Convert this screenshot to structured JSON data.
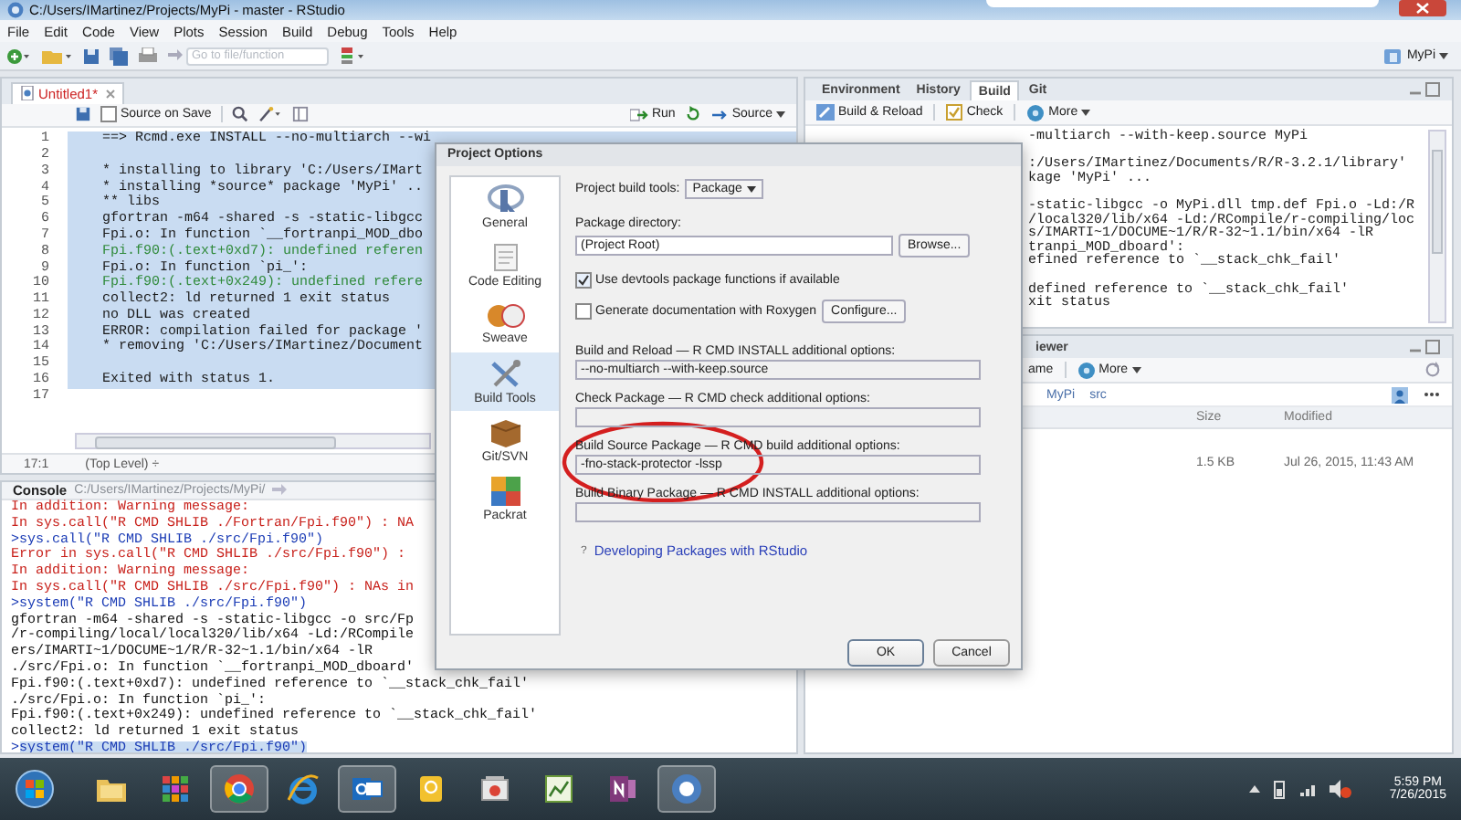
{
  "window": {
    "title": "C:/Users/IMartinez/Projects/MyPi - master - RStudio"
  },
  "menu": [
    "File",
    "Edit",
    "Code",
    "View",
    "Plots",
    "Session",
    "Build",
    "Debug",
    "Tools",
    "Help"
  ],
  "toolbar": {
    "goto_placeholder": "Go to file/function",
    "project": "MyPi"
  },
  "editor": {
    "tabs": [
      {
        "label": "Untitled1*",
        "selected": true,
        "modified": true
      }
    ],
    "source_on_save": {
      "label": "Source on Save",
      "checked": false
    },
    "run": "Run",
    "source": "Source",
    "lines": [
      {
        "number": "1",
        "text": "==> Rcmd.exe INSTALL --no-multiarch --wi",
        "kind": "plain",
        "selected": true
      },
      {
        "number": "2",
        "selected": true
      },
      {
        "number": "3",
        "text": "* installing to library 'C:/Users/IMart",
        "kind": "plain",
        "selected": true
      },
      {
        "number": "4",
        "text": "* installing *source* package 'MyPi' ..",
        "kind": "plain",
        "selected": true
      },
      {
        "number": "5",
        "text": "** libs",
        "kind": "plain",
        "selected": true
      },
      {
        "number": "6",
        "text": "gfortran -m64 -shared -s -static-libgcc",
        "kind": "plain",
        "selected": true
      },
      {
        "number": "7",
        "text": "Fpi.o: In function `__fortranpi_MOD_dbo",
        "kind": "plain",
        "selected": true
      },
      {
        "number": "8",
        "text": "Fpi.f90:(.text+0xd7): undefined referen",
        "kind": "warning",
        "selected": true
      },
      {
        "number": "9",
        "text": "Fpi.o: In function `pi_':",
        "kind": "plain",
        "selected": true
      },
      {
        "number": "10",
        "text": "Fpi.f90:(.text+0x249): undefined refere",
        "kind": "warning",
        "selected": true
      },
      {
        "number": "11",
        "text": "collect2: ld returned 1 exit status",
        "kind": "plain",
        "selected": true
      },
      {
        "number": "12",
        "text": "no DLL was created",
        "kind": "plain",
        "selected": true
      },
      {
        "number": "13",
        "text": "ERROR: compilation failed for package '",
        "kind": "plain",
        "selected": true
      },
      {
        "number": "14",
        "text": "* removing 'C:/Users/IMartinez/Document",
        "kind": "plain",
        "selected": true
      },
      {
        "number": "15",
        "selected": true
      },
      {
        "number": "16",
        "text": "Exited with status 1.",
        "kind": "plain",
        "selected": true
      },
      {
        "number": "17",
        "selected": false
      }
    ],
    "position": "17:1",
    "scope": "(Top Level) ÷"
  },
  "console": {
    "title": "Console",
    "path": "C:/Users/IMartinez/Projects/MyPi/",
    "lines": [
      {
        "text": "In addition: Warning message:",
        "kind": "error",
        "selected": false
      },
      {
        "text": "In sys.call(\"R CMD SHLIB ./Fortran/Fpi.f90\") : NA",
        "kind": "error",
        "selected": false
      },
      {
        "prompt": ">",
        "text": "sys.call(\"R CMD SHLIB ./src/Fpi.f90\")",
        "kind": "command",
        "selected": false
      },
      {
        "text": "Error in sys.call(\"R CMD SHLIB ./src/Fpi.f90\") :",
        "kind": "error",
        "selected": false
      },
      {
        "text": "In addition: Warning message:",
        "kind": "error",
        "selected": false
      },
      {
        "text": "In sys.call(\"R CMD SHLIB ./src/Fpi.f90\") : NAs in",
        "kind": "error",
        "selected": false
      },
      {
        "prompt": ">",
        "text": "system(\"R CMD SHLIB ./src/Fpi.f90\")",
        "kind": "command",
        "selected": false
      },
      {
        "text": "gfortran -m64 -shared -s -static-libgcc -o src/Fp",
        "kind": "output",
        "selected": false
      },
      {
        "text": "/r-compiling/local/local320/lib/x64 -Ld:/RCompile",
        "kind": "output",
        "selected": false
      },
      {
        "text": "ers/IMARTI~1/DOCUME~1/R/R-32~1.1/bin/x64 -lR",
        "kind": "output",
        "selected": false
      },
      {
        "text": "./src/Fpi.o: In function `__fortranpi_MOD_dboard'",
        "kind": "output",
        "selected": false
      },
      {
        "text": "Fpi.f90:(.text+0xd7): undefined reference to `__stack_chk_fail'",
        "kind": "output",
        "selected": false
      },
      {
        "text": "./src/Fpi.o: In function `pi_':",
        "kind": "output",
        "selected": false
      },
      {
        "text": "Fpi.f90:(.text+0x249): undefined reference to `__stack_chk_fail'",
        "kind": "output",
        "selected": false
      },
      {
        "text": "collect2: ld returned 1 exit status",
        "kind": "output",
        "selected": false
      },
      {
        "prompt": ">",
        "text": "system(\"R CMD SHLIB ./src/Fpi.f90\")",
        "kind": "command",
        "selected": true
      }
    ]
  },
  "env_pane": {
    "tabs": [
      {
        "label": "Environment",
        "selected": false
      },
      {
        "label": "History",
        "selected": false
      },
      {
        "label": "Build",
        "selected": true
      },
      {
        "label": "Git",
        "selected": false
      }
    ],
    "actions": [
      {
        "label": "Build & Reload",
        "kind": "build"
      },
      {
        "label": "Check",
        "kind": "check"
      },
      {
        "label": "More",
        "kind": "more"
      }
    ],
    "output": [
      [
        "-multiarch --with-keep.source MyPi"
      ],
      [
        ":/Users/IMartinez/Documents/R/R-3.2.1/library'",
        "kage 'MyPi' ..."
      ],
      [
        "-static-libgcc -o MyPi.dll tmp.def Fpi.o -Ld:/R",
        "/local320/lib/x64 -Ld:/RCompile/r-compiling/loc",
        "s/IMARTI~1/DOCUME~1/R/R-32~1.1/bin/x64 -lR",
        "tranpi_MOD_dboard':",
        "efined reference to `__stack_chk_fail'"
      ],
      [
        "defined reference to `__stack_chk_fail'",
        "xit status"
      ]
    ]
  },
  "files_pane": {
    "tabs": [
      {
        "label": "iewer",
        "selected": false
      }
    ],
    "actions": [
      {
        "label": "ame",
        "kind": "plain"
      },
      {
        "label": "More",
        "kind": "more"
      }
    ],
    "path": [
      "MyPi",
      "src"
    ],
    "columns": [
      "Size",
      "Modified"
    ],
    "rows": [
      {
        "size": "1.5 KB",
        "modified": "Jul 26, 2015, 11:43 AM"
      }
    ]
  },
  "dialog": {
    "title": "Project Options",
    "sections": [
      {
        "label": "General",
        "kind": "r",
        "selected": false
      },
      {
        "label": "Code Editing",
        "kind": "document",
        "selected": false
      },
      {
        "label": "Sweave",
        "kind": "sweave",
        "selected": false
      },
      {
        "label": "Build Tools",
        "kind": "tools",
        "selected": true
      },
      {
        "label": "Git/SVN",
        "kind": "box",
        "selected": false
      },
      {
        "label": "Packrat",
        "kind": "packrat",
        "selected": false
      }
    ],
    "build_tools": {
      "label": "Project build tools:",
      "value": "Package"
    },
    "package_dir": {
      "label": "Package directory:",
      "value": "(Project Root)",
      "button": "Browse..."
    },
    "options": [
      {
        "label": "Use devtools package functions if available",
        "checked": true
      },
      {
        "label": "Generate documentation with Roxygen",
        "checked": false,
        "button": "Configure..."
      }
    ],
    "fields": [
      {
        "label": "Build and Reload — R CMD INSTALL additional options:",
        "value": "--no-multiarch --with-keep.source",
        "circled": false
      },
      {
        "label": "Check Package — R CMD check additional options:",
        "circled": false
      },
      {
        "label": "Build Source Package — R CMD build additional options:",
        "value": "-fno-stack-protector -lssp",
        "circled": true
      },
      {
        "label": "Build Binary Package — R CMD INSTALL additional options:",
        "circled": false
      }
    ],
    "help_mark": "?",
    "help_link": "Developing Packages with RStudio",
    "buttons": [
      "OK",
      "Cancel"
    ]
  },
  "taskbar": {
    "apps": [
      {
        "kind": "folder",
        "active": false
      },
      {
        "kind": "grid",
        "active": false
      },
      {
        "kind": "chrome",
        "active": true
      },
      {
        "kind": "ie",
        "active": false
      },
      {
        "kind": "outlook",
        "active": true
      },
      {
        "kind": "bulb",
        "active": false
      },
      {
        "kind": "photos",
        "active": false
      },
      {
        "kind": "project",
        "active": false
      },
      {
        "kind": "onenote",
        "active": false
      },
      {
        "kind": "r",
        "active": true
      }
    ],
    "time": "5:59 PM",
    "date": "7/26/2015"
  }
}
